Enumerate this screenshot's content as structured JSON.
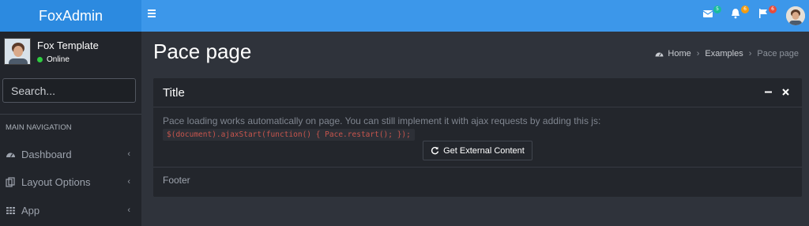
{
  "app": {
    "logo": "FoxAdmin"
  },
  "topbar": {
    "messages_count": "5",
    "notifications_count": "6",
    "flags_count": "6",
    "colors": {
      "messages_badge": "#1abc9c",
      "notifications_badge": "#f39c12",
      "flags_badge": "#e74c3c"
    }
  },
  "sidebar": {
    "user_name": "Fox Template",
    "user_status": "Online",
    "search_placeholder": "Search...",
    "nav_header": "MAIN NAVIGATION",
    "items": [
      {
        "label": "Dashboard",
        "icon": "dashboard-icon"
      },
      {
        "label": "Layout Options",
        "icon": "copy-icon"
      },
      {
        "label": "App",
        "icon": "grid-icon"
      }
    ]
  },
  "page": {
    "title": "Pace page",
    "breadcrumb": [
      "Home",
      "Examples",
      "Pace page"
    ]
  },
  "box": {
    "title": "Title",
    "text": "Pace loading works automatically on page. You can still implement it with ajax requests by adding this js:",
    "code": "$(document).ajaxStart(function() { Pace.restart(); });",
    "button_label": "Get External Content",
    "footer": "Footer"
  }
}
